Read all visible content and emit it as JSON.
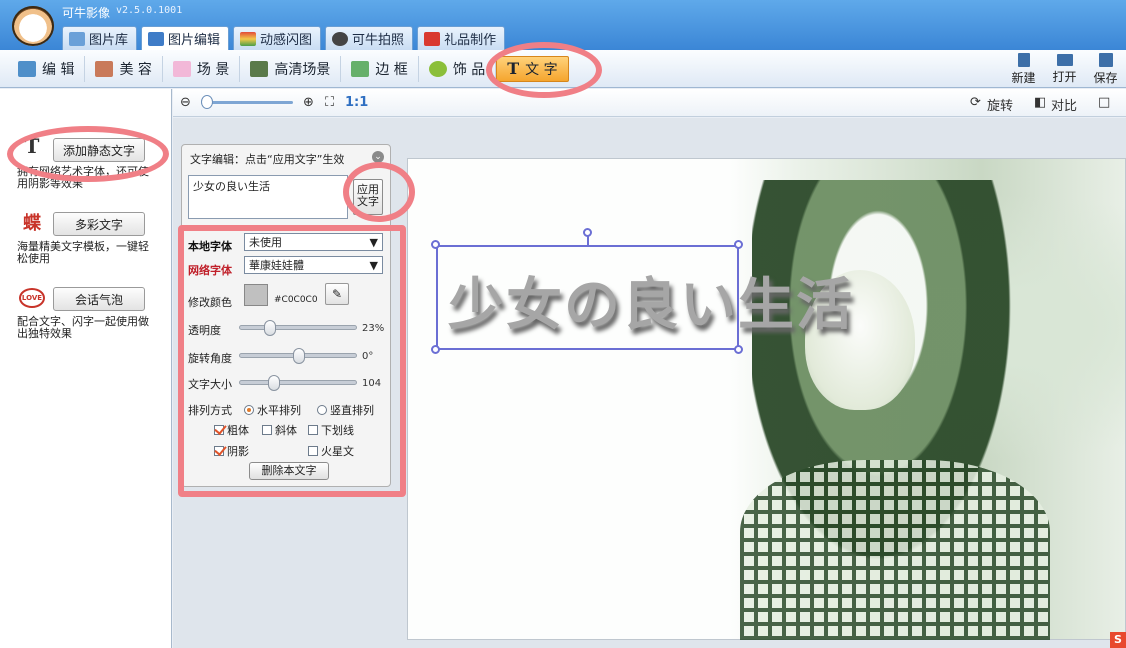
{
  "app": {
    "title": "可牛影像",
    "version": "v2.5.0.1001"
  },
  "main_tabs": [
    {
      "label": "图片库"
    },
    {
      "label": "图片编辑"
    },
    {
      "label": "动感闪图"
    },
    {
      "label": "可牛拍照"
    },
    {
      "label": "礼品制作"
    }
  ],
  "toolbar": {
    "items": [
      {
        "label": "编 辑"
      },
      {
        "label": "美 容"
      },
      {
        "label": "场 景"
      },
      {
        "label": "高清场景"
      },
      {
        "label": "边 框"
      },
      {
        "label": "饰 品"
      },
      {
        "label": "文 字"
      }
    ],
    "right": [
      {
        "label": "新建"
      },
      {
        "label": "打开"
      },
      {
        "label": "保存"
      }
    ]
  },
  "zoom": {
    "ratio_label": "1:1",
    "rotate_label": "旋转",
    "compare_label": "对比"
  },
  "left_panel": {
    "static_text": {
      "button": "添加静态文字",
      "desc": "拥有网络艺术字体，还可使用阴影等效果"
    },
    "colorful_text": {
      "button": "多彩文字",
      "desc": "海量精美文字模板，一键轻松使用"
    },
    "bubble": {
      "button": "会话气泡",
      "desc": "配合文字、闪字一起使用做出独特效果"
    }
  },
  "edit_panel": {
    "title": "文字编辑：点击“应用文字”生效",
    "text_value": "少女の良い生活",
    "apply_label": "应用文字",
    "local_font_label": "本地字体",
    "local_font_value": "未使用",
    "net_font_label": "网络字体",
    "net_font_value": "華康娃娃體",
    "color_label": "修改颜色",
    "color_value": "#C0C0C0",
    "opacity_label": "透明度",
    "opacity_value": "23%",
    "opacity_fraction": 0.23,
    "rotate_label": "旋转角度",
    "rotate_value": "0°",
    "size_label": "文字大小",
    "size_value": "104",
    "layout_label": "排列方式",
    "horizontal_label": "水平排列",
    "vertical_label": "竖直排列",
    "bold_label": "粗体",
    "italic_label": "斜体",
    "underline_label": "下划线",
    "shadow_label": "阴影",
    "mars_label": "火星文",
    "delete_label": "删除本文字"
  },
  "canvas": {
    "overlay_text": "少女の良い生活"
  },
  "colors": {
    "accent": "#3b86d6",
    "highlight": "#f07f86",
    "selection": "#6b6fd4"
  }
}
